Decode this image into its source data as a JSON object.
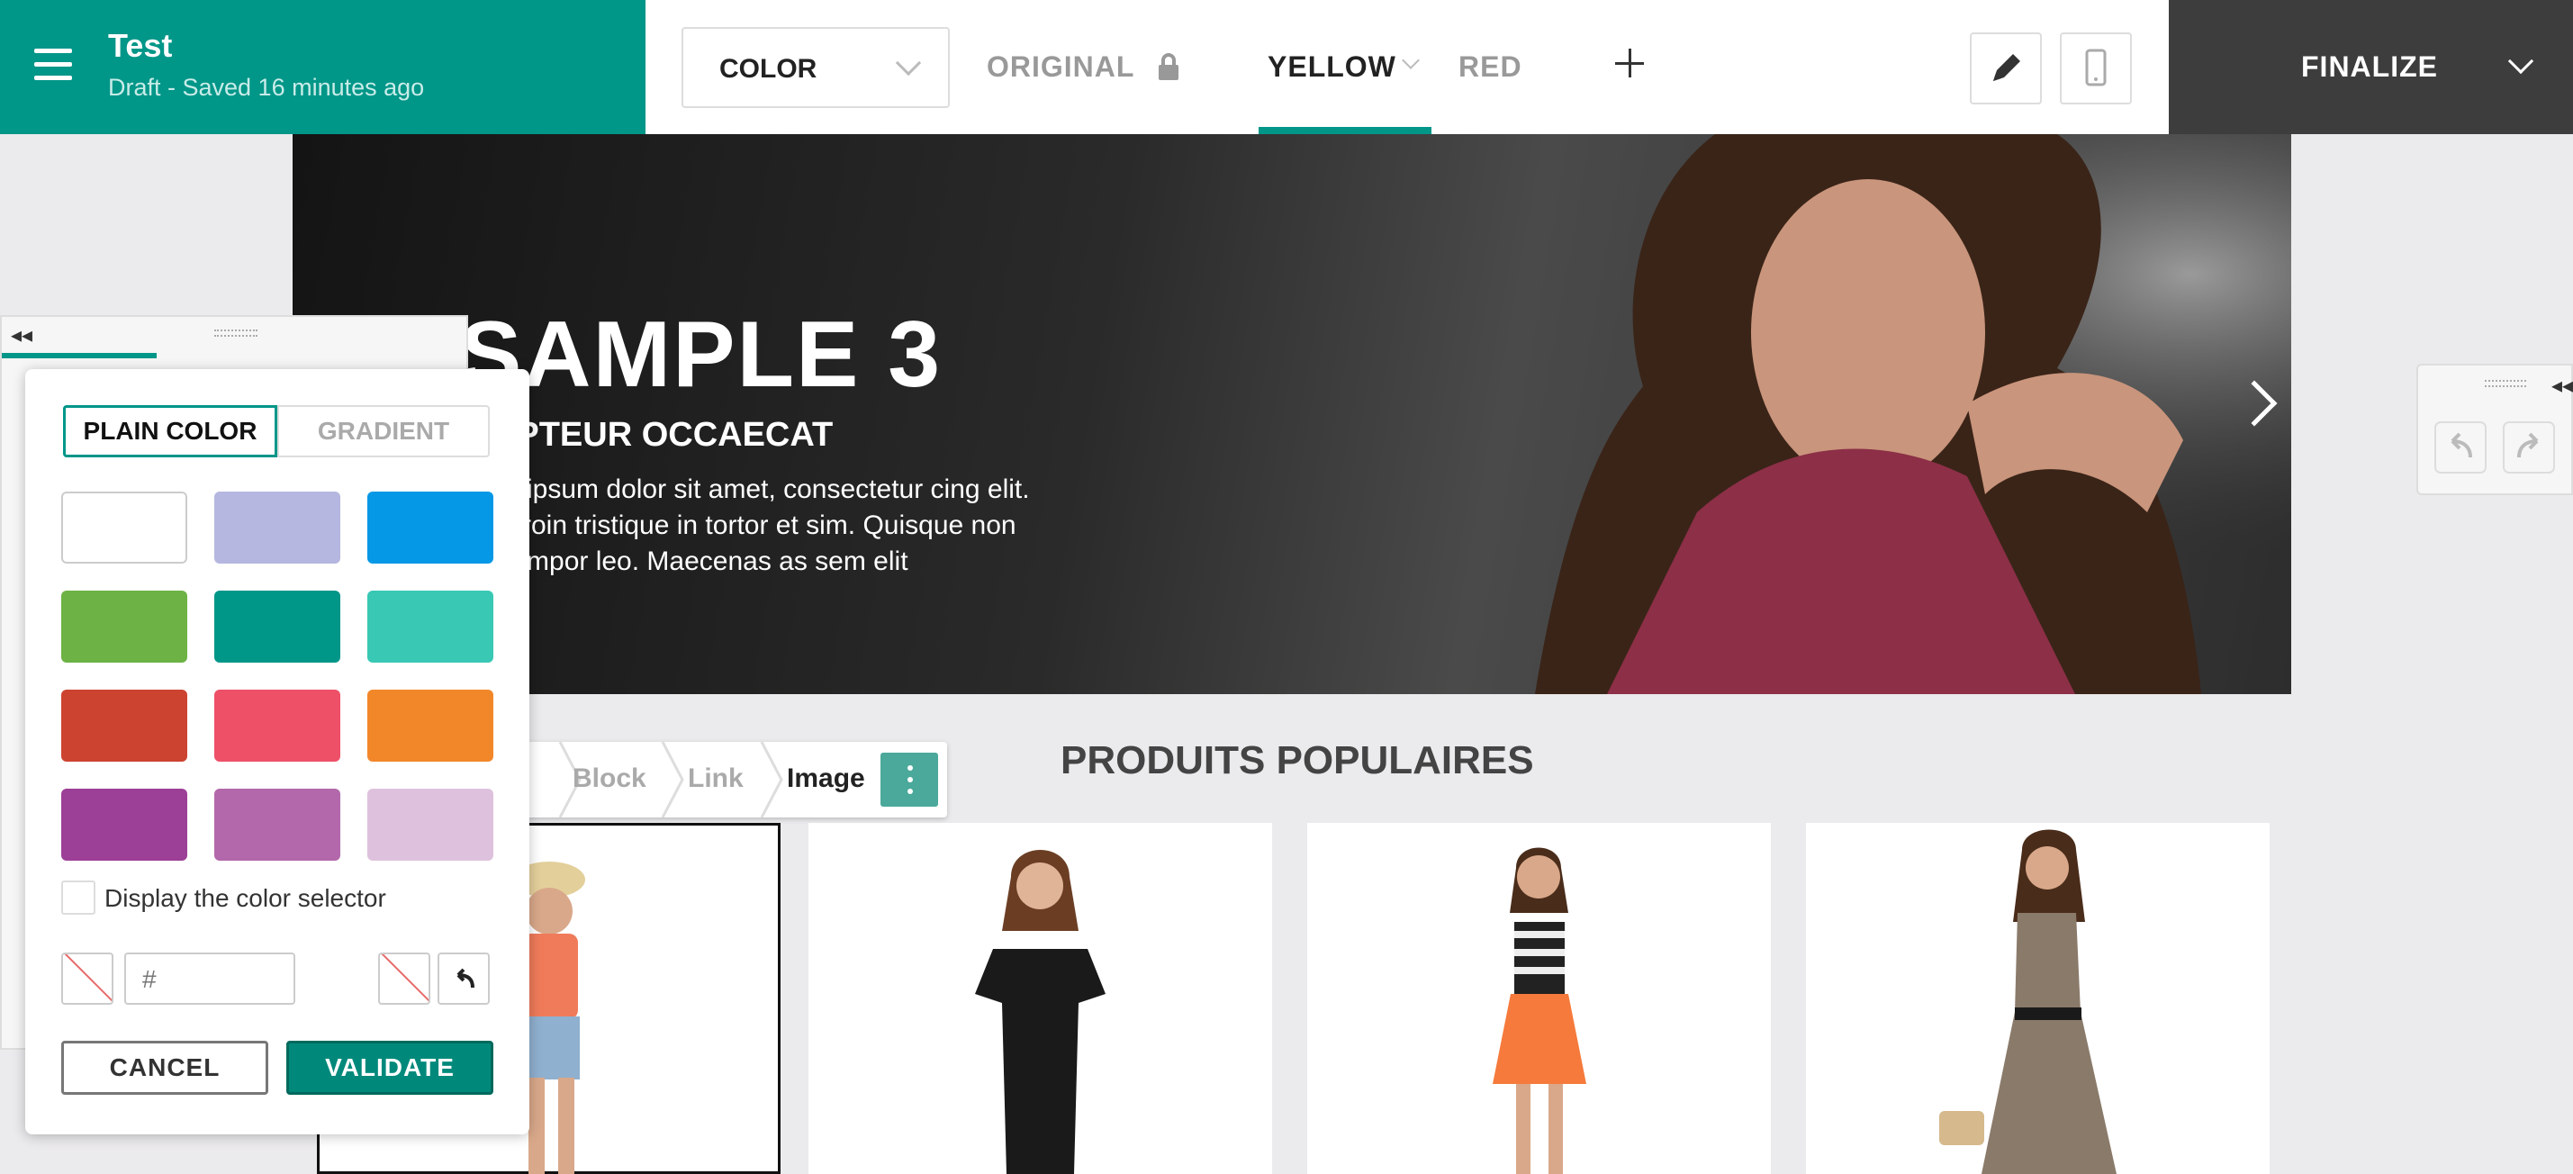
{
  "app": {
    "title": "Test",
    "status": "Draft - Saved 16 minutes ago"
  },
  "toolbar": {
    "mode_select": "COLOR",
    "tabs": [
      {
        "label": "ORIGINAL",
        "locked": true
      },
      {
        "label": "YELLOW",
        "active": true
      },
      {
        "label": "RED"
      }
    ],
    "finalize_label": "FINALIZE",
    "icons": [
      "menu-icon",
      "chevron-down-icon",
      "lock-icon",
      "plus-icon",
      "pencil-icon",
      "mobile-icon"
    ]
  },
  "hero": {
    "title": "SAMPLE 3",
    "subtitle": "EPTEUR OCCAECAT",
    "text": "n ipsum dolor sit amet, consectetur cing elit. Proin tristique in tortor et sim. Quisque non tempor leo. Maecenas as sem elit"
  },
  "section": {
    "title": "PRODUITS POPULAIRES"
  },
  "breadcrumb": {
    "items": [
      "Block",
      "Link"
    ],
    "current": "Image"
  },
  "color_popup": {
    "tab_plain": "PLAIN COLOR",
    "tab_gradient": "GRADIENT",
    "swatches": [
      "#ffffff",
      "#b5b7e0",
      "#0598e6",
      "#6db244",
      "#009688",
      "#38c8b4",
      "#cc4330",
      "#ee5068",
      "#f2872a",
      "#9c3f96",
      "#b268aa",
      "#dec2dd"
    ],
    "checkbox_label": "Display the color selector",
    "hex_placeholder": "#",
    "cancel_label": "CANCEL",
    "validate_label": "VALIDATE"
  }
}
